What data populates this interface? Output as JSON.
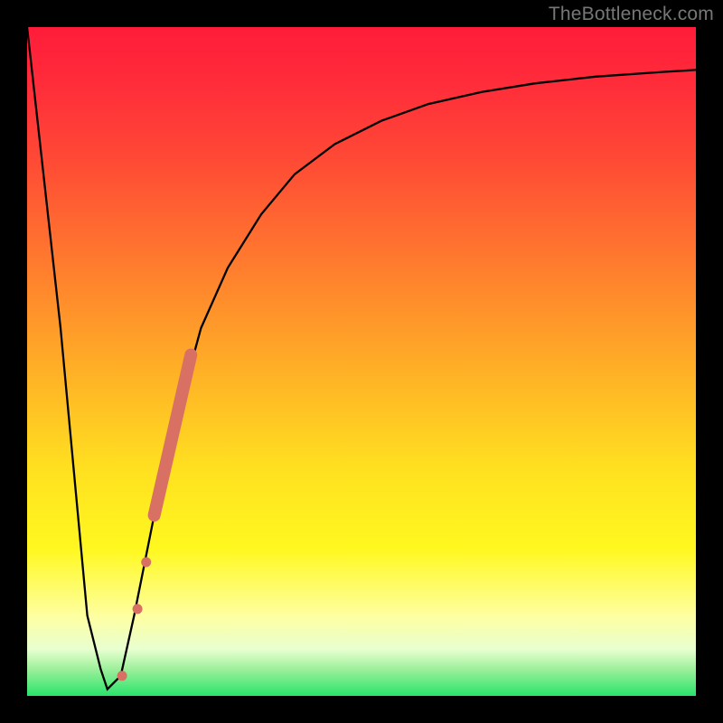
{
  "watermark": "TheBottleneck.com",
  "chart_data": {
    "type": "line",
    "title": "",
    "xlabel": "",
    "ylabel": "",
    "xlim": [
      0,
      100
    ],
    "ylim": [
      0,
      100
    ],
    "series": [
      {
        "name": "bottleneck-curve",
        "x": [
          0,
          5,
          9,
          11,
          12,
          14,
          16,
          18,
          20,
          23,
          26,
          30,
          35,
          40,
          46,
          53,
          60,
          68,
          76,
          85,
          95,
          100
        ],
        "y": [
          100,
          55,
          12,
          4,
          1,
          3,
          12,
          22,
          32,
          44,
          55,
          64,
          72,
          78,
          82.5,
          86,
          88.5,
          90.3,
          91.6,
          92.6,
          93.3,
          93.6
        ]
      }
    ],
    "markers": [
      {
        "name": "marker-a",
        "x": 14.2,
        "y": 3,
        "r": 5.5,
        "color": "#d87064"
      },
      {
        "name": "marker-b",
        "x": 16.5,
        "y": 13,
        "r": 5.5,
        "color": "#d87064"
      },
      {
        "name": "marker-c",
        "x": 17.8,
        "y": 20,
        "r": 5.5,
        "color": "#d87064"
      },
      {
        "name": "marker-stroke",
        "x0": 19.0,
        "y0": 27,
        "x1": 24.5,
        "y1": 51,
        "w": 14,
        "color": "#d87064"
      }
    ],
    "background_gradient": {
      "stops": [
        {
          "pos": 0,
          "color": "#ff1c3a"
        },
        {
          "pos": 35,
          "color": "#ff7a2e"
        },
        {
          "pos": 66,
          "color": "#ffe020"
        },
        {
          "pos": 88,
          "color": "#feffa0"
        },
        {
          "pos": 100,
          "color": "#29e36b"
        }
      ]
    }
  }
}
